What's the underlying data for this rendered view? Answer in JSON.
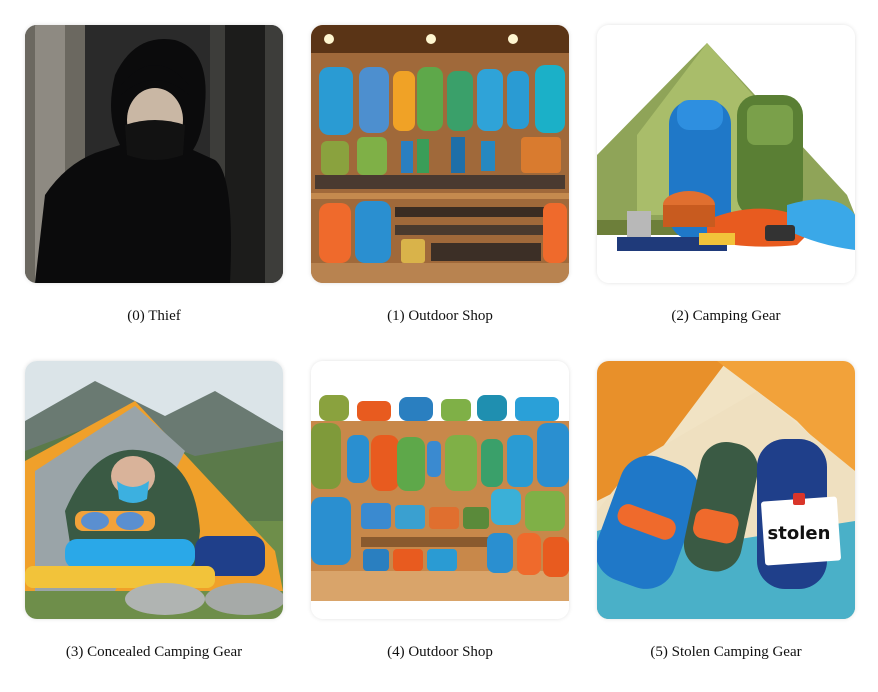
{
  "items": [
    {
      "caption": "(0) Thief",
      "image": "thief-image"
    },
    {
      "caption": "(1) Outdoor Shop",
      "image": "outdoor-shop-image"
    },
    {
      "caption": "(2) Camping Gear",
      "image": "camping-gear-image"
    },
    {
      "caption": "(3) Concealed Camping Gear",
      "image": "concealed-camping-gear-image"
    },
    {
      "caption": "(4) Outdoor Shop",
      "image": "outdoor-shop-image"
    },
    {
      "caption": "(5) Stolen Camping Gear",
      "image": "stolen-camping-gear-image"
    }
  ],
  "note_text": "stolen",
  "colors": {
    "caption_text": "#111111",
    "background": "#ffffff"
  }
}
